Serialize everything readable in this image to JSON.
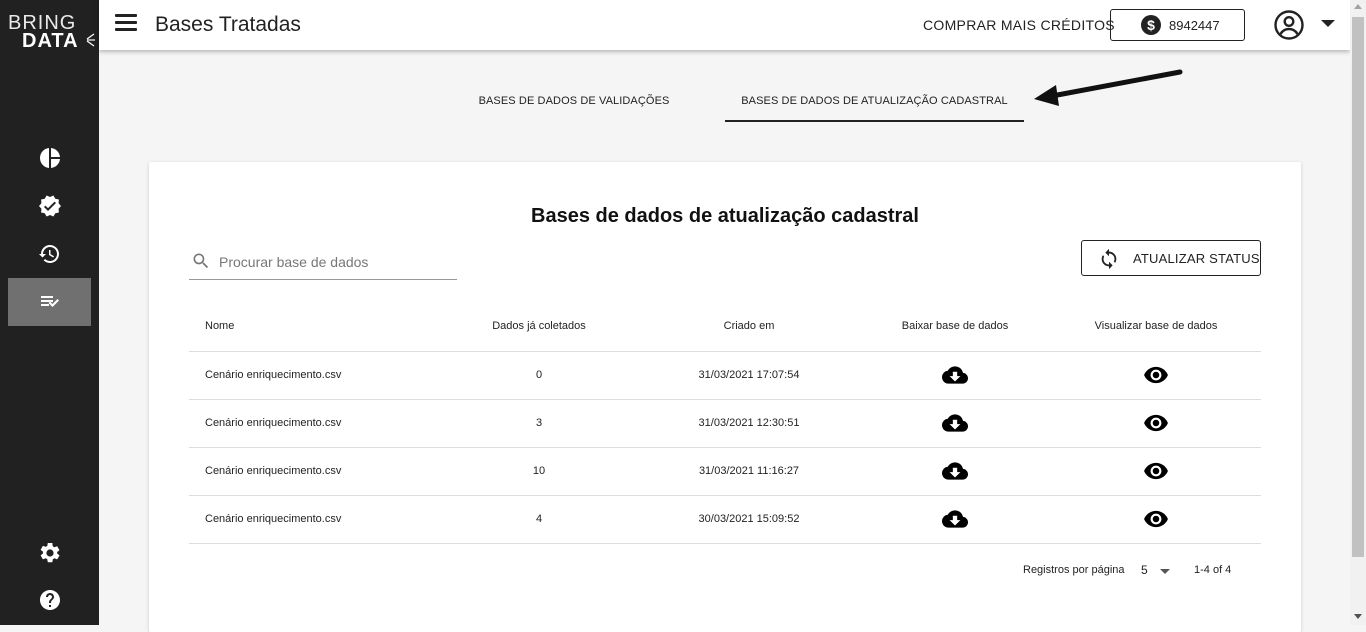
{
  "brand": {
    "line1": "BRING",
    "line2": "DATA"
  },
  "sidebar": {
    "items": [
      {
        "icon": "pie-chart-icon"
      },
      {
        "icon": "verified-badge-icon"
      },
      {
        "icon": "history-icon"
      },
      {
        "icon": "playlist-check-icon",
        "active": true
      }
    ],
    "bottom": [
      {
        "icon": "gear-icon"
      },
      {
        "icon": "help-icon"
      }
    ]
  },
  "header": {
    "title": "Bases Tratadas",
    "buy_credits": "COMPRAR MAIS CRÉDITOS",
    "credits_symbol": "$",
    "credits_value": "8942447"
  },
  "tabs": [
    {
      "label": "BASES DE DADOS DE VALIDAÇÕES",
      "active": false
    },
    {
      "label": "BASES DE DADOS DE ATUALIZAÇÃO CADASTRAL",
      "active": true
    }
  ],
  "main": {
    "title": "Bases de dados de atualização cadastral",
    "search_placeholder": "Procurar base de dados",
    "refresh_label": "ATUALIZAR STATUS",
    "columns": [
      "Nome",
      "Dados já coletados",
      "Criado em",
      "Baixar base de dados",
      "Visualizar base de dados"
    ],
    "rows": [
      {
        "name": "Cenário enriquecimento.csv",
        "collected": "0",
        "created": "31/03/2021 17:07:54"
      },
      {
        "name": "Cenário enriquecimento.csv",
        "collected": "3",
        "created": "31/03/2021 12:30:51"
      },
      {
        "name": "Cenário enriquecimento.csv",
        "collected": "10",
        "created": "31/03/2021 11:16:27"
      },
      {
        "name": "Cenário enriquecimento.csv",
        "collected": "4",
        "created": "30/03/2021 15:09:52"
      }
    ],
    "pagination": {
      "label": "Registros por página",
      "per_page": "5",
      "range": "1-4 of 4"
    }
  },
  "colors": {
    "sidebar": "#212121",
    "sidebar_active": "#707070",
    "accent": "#222222"
  }
}
